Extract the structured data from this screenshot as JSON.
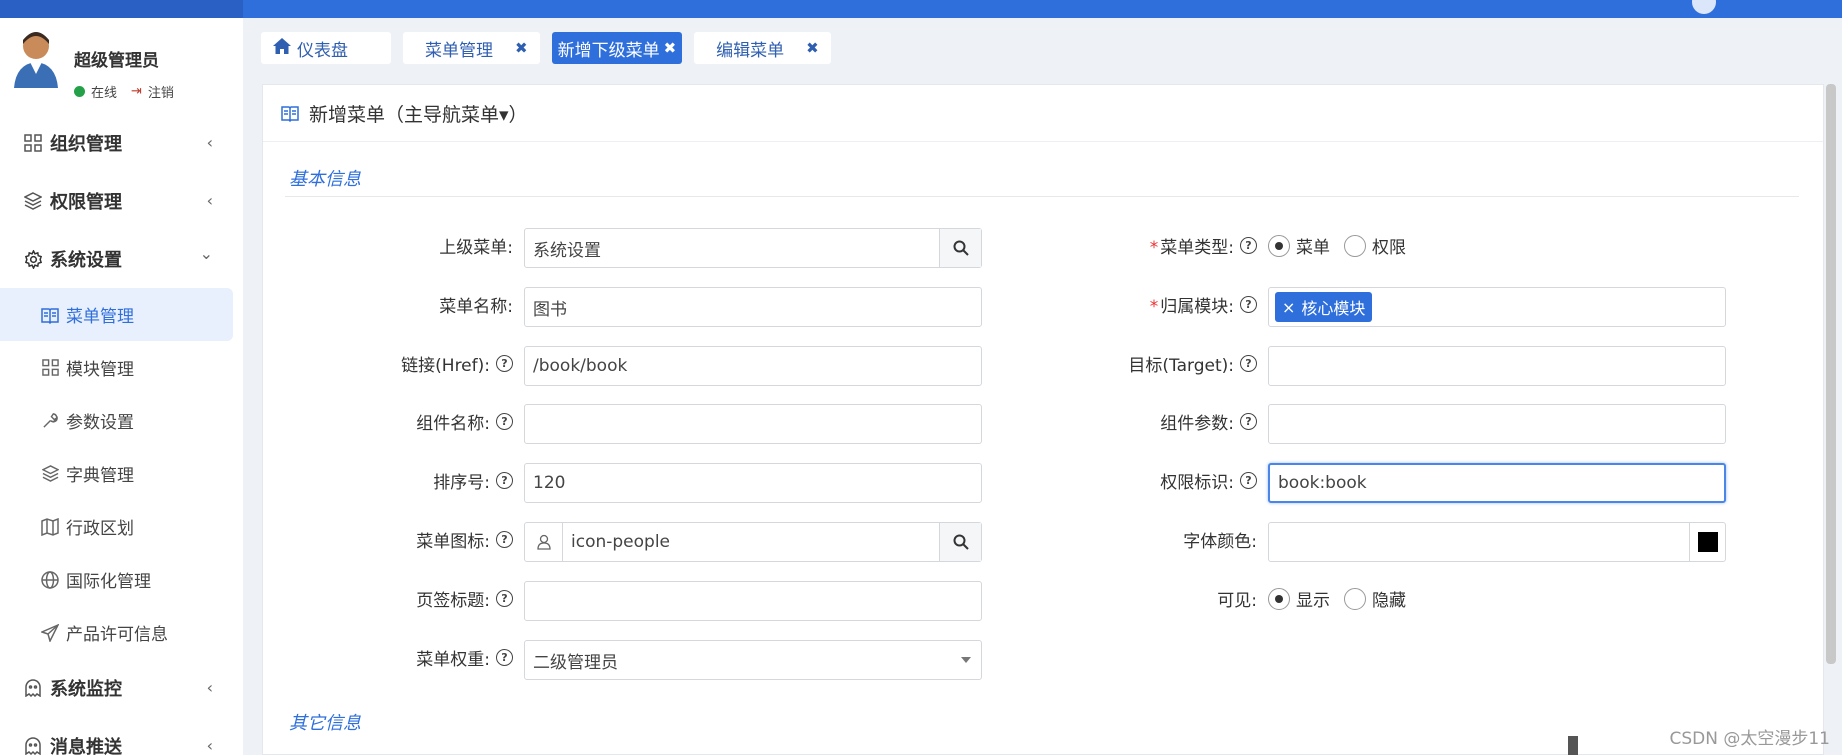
{
  "user": {
    "name": "超级管理员",
    "status": "在线",
    "logout": "注销"
  },
  "nav": {
    "groups": [
      {
        "label": "组织管理",
        "icon": "grid-icon",
        "arrow": "‹"
      },
      {
        "label": "权限管理",
        "icon": "layers-icon",
        "arrow": "‹"
      },
      {
        "label": "系统设置",
        "icon": "gear-icon",
        "arrow": "⌄"
      }
    ],
    "sub": [
      {
        "label": "菜单管理",
        "icon": "book-icon"
      },
      {
        "label": "模块管理",
        "icon": "grid-icon"
      },
      {
        "label": "参数设置",
        "icon": "wrench-icon"
      },
      {
        "label": "字典管理",
        "icon": "layers-icon"
      },
      {
        "label": "行政区划",
        "icon": "map-icon"
      },
      {
        "label": "国际化管理",
        "icon": "globe-icon"
      },
      {
        "label": "产品许可信息",
        "icon": "send-icon"
      }
    ],
    "groups2": [
      {
        "label": "系统监控",
        "icon": "ghost-icon",
        "arrow": "‹"
      },
      {
        "label": "消息推送",
        "icon": "ghost-icon",
        "arrow": "‹"
      }
    ]
  },
  "tabs": [
    {
      "label": "仪表盘",
      "close": ""
    },
    {
      "label": "菜单管理",
      "close": "✖"
    },
    {
      "label": "新增下级菜单",
      "close": "✖"
    },
    {
      "label": "编辑菜单",
      "close": "✖"
    }
  ],
  "panel": {
    "title": "新增菜单（主导航菜单▾）",
    "section_basic": "基本信息",
    "section_other": "其它信息"
  },
  "form": {
    "parent": {
      "label": "上级菜单:",
      "value": "系统设置"
    },
    "name": {
      "label": "菜单名称:",
      "value": "图书"
    },
    "href": {
      "label": "链接(Href):",
      "value": "/book/book"
    },
    "component": {
      "label": "组件名称:",
      "value": ""
    },
    "sort": {
      "label": "排序号:",
      "value": "120"
    },
    "icon": {
      "label": "菜单图标:",
      "value": "icon-people"
    },
    "tab_title": {
      "label": "页签标题:",
      "value": ""
    },
    "weight": {
      "label": "菜单权重:",
      "value": "二级管理员"
    },
    "type": {
      "label": "菜单类型:",
      "options": [
        "菜单",
        "权限"
      ],
      "selected": "菜单"
    },
    "module": {
      "label": "归属模块:",
      "tag": "核心模块"
    },
    "target": {
      "label": "目标(Target):",
      "value": ""
    },
    "component_params": {
      "label": "组件参数:",
      "value": ""
    },
    "permission": {
      "label": "权限标识:",
      "value": "book:book"
    },
    "font_color": {
      "label": "字体颜色:",
      "value": "",
      "swatch": "#000000"
    },
    "visible": {
      "label": "可见:",
      "options": [
        "显示",
        "隐藏"
      ],
      "selected": "显示"
    }
  },
  "watermark": "CSDN @太空漫步11",
  "colors": {
    "accent": "#2f6fdc",
    "topbar": "#2f6fdc",
    "required": "#ee3333"
  }
}
